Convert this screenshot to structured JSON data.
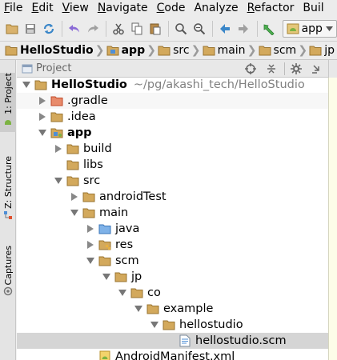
{
  "menu": {
    "items": [
      {
        "mnemonic": "F",
        "rest": "ile"
      },
      {
        "mnemonic": "E",
        "rest": "dit"
      },
      {
        "mnemonic": "V",
        "rest": "iew"
      },
      {
        "mnemonic": "N",
        "rest": "avigate"
      },
      {
        "mnemonic": "C",
        "rest": "ode"
      },
      {
        "mnemonic": "",
        "rest": "Analyze"
      },
      {
        "mnemonic": "R",
        "rest": "efactor"
      },
      {
        "mnemonic": "",
        "rest": "Buil"
      }
    ]
  },
  "toolbar": {
    "run_config_label": "app"
  },
  "breadcrumb": {
    "items": [
      "HelloStudio",
      "app",
      "src",
      "main",
      "scm",
      "jp"
    ]
  },
  "left_strip": {
    "project_tab": "1: Project",
    "structure_tab": "Z: Structure",
    "captures_tab": "Captures"
  },
  "panel": {
    "title": "Project"
  },
  "tree": {
    "root_name": "HelloStudio",
    "root_path": "~/pg/akashi_tech/HelloStudio",
    "gradle": ".gradle",
    "idea": ".idea",
    "app": "app",
    "build": "build",
    "libs": "libs",
    "src": "src",
    "androidTest": "androidTest",
    "main": "main",
    "java": "java",
    "res": "res",
    "scm": "scm",
    "jp": "jp",
    "co": "co",
    "example": "example",
    "hellostudio": "hellostudio",
    "file": "hellostudio.scm",
    "manifest": "AndroidManifest.xml"
  },
  "colors": {
    "folder": "#c8a465",
    "folder_blue": "#4f8fd6",
    "excluded_folder": "#e0502f",
    "selection": "#d5d5d5"
  }
}
